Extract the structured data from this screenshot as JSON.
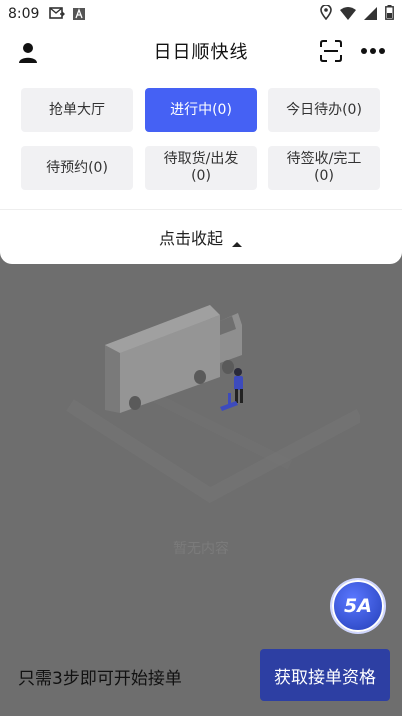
{
  "status_bar": {
    "time": "8:09"
  },
  "header": {
    "title": "日日顺快线"
  },
  "tabs": [
    {
      "label": "抢单大厅",
      "active": false
    },
    {
      "label": "进行中(0)",
      "active": true
    },
    {
      "label": "今日待办(0)",
      "active": false
    },
    {
      "label": "待预约(0)",
      "active": false
    },
    {
      "label": "待取货/出发\n(0)",
      "active": false
    },
    {
      "label": "待签收/完工\n(0)",
      "active": false
    }
  ],
  "collapse": {
    "label": "点击收起"
  },
  "empty_state": {
    "text": "暂无内容"
  },
  "badge": {
    "label": "5A"
  },
  "bottom_bar": {
    "hint": "只需3步即可开始接单",
    "button_label": "获取接单资格"
  },
  "colors": {
    "accent": "#4561f4",
    "button_dark": "#2d3fa3",
    "overlay": "#6e6e6e"
  }
}
